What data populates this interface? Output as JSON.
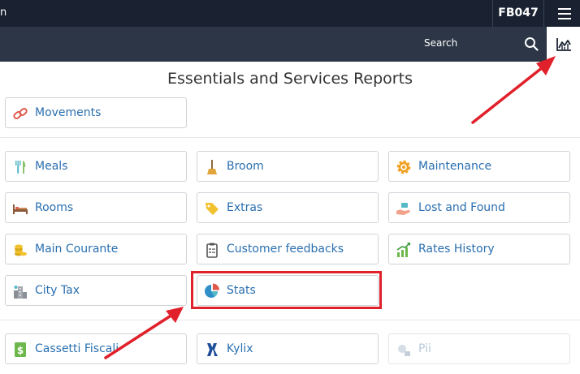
{
  "header": {
    "brand_fragment": "n",
    "property_code": "FB047",
    "menu_icon": "hamburger-icon"
  },
  "search": {
    "label": "Search",
    "icon": "search-icon"
  },
  "stats_tab": {
    "icon": "bar-chart-icon"
  },
  "page": {
    "title": "Essentials and Services Reports"
  },
  "reports": {
    "movements": {
      "label": "Movements",
      "icon": "link-chain-icon"
    },
    "meals": {
      "label": "Meals",
      "icon": "cutlery-icon"
    },
    "broom": {
      "label": "Broom",
      "icon": "broom-icon"
    },
    "maintenance": {
      "label": "Maintenance",
      "icon": "gear-icon"
    },
    "rooms": {
      "label": "Rooms",
      "icon": "bed-icon"
    },
    "extras": {
      "label": "Extras",
      "icon": "tag-icon"
    },
    "lost_found": {
      "label": "Lost and Found",
      "icon": "hand-box-icon"
    },
    "main_courante": {
      "label": "Main Courante",
      "icon": "coins-icon"
    },
    "customer_feedbacks": {
      "label": "Customer feedbacks",
      "icon": "clipboard-icon"
    },
    "rates_history": {
      "label": "Rates History",
      "icon": "growth-chart-icon"
    },
    "city_tax": {
      "label": "City Tax",
      "icon": "city-icon"
    },
    "stats": {
      "label": "Stats",
      "icon": "pie-chart-icon"
    },
    "cassetti_fiscali": {
      "label": "Cassetti Fiscali",
      "icon": "dollar-document-icon"
    },
    "kylix": {
      "label": "Kylix",
      "icon": "kylix-logo-icon"
    },
    "pii": {
      "label": "Pii",
      "icon": "pii-icon"
    }
  },
  "colors": {
    "topbar": "#1a2232",
    "searchbar": "#2c3646",
    "link": "#2a6fb0",
    "annotation": "#e0202a"
  }
}
